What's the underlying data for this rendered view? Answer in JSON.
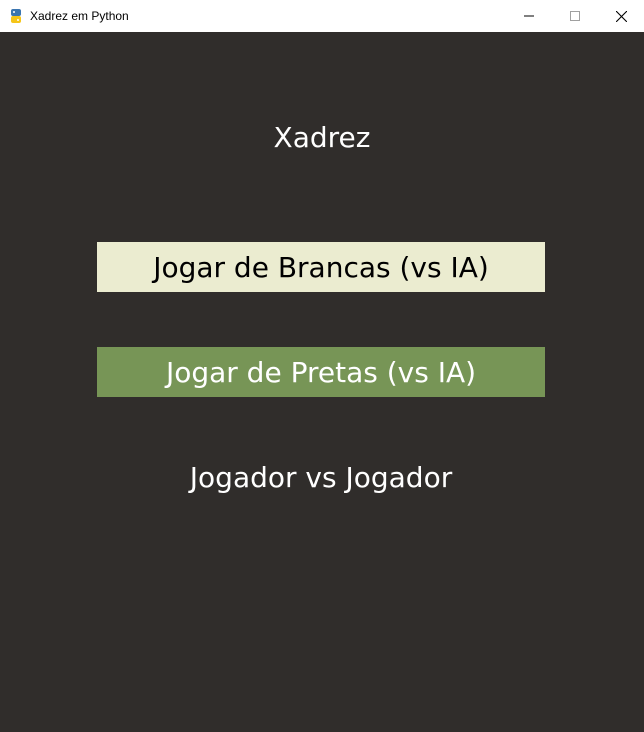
{
  "window": {
    "title": "Xadrez em Python",
    "icon": "python-icon",
    "controls": {
      "minimize_icon": "minimize-icon",
      "maximize_icon": "maximize-icon",
      "close_icon": "close-icon"
    }
  },
  "menu": {
    "title": "Xadrez",
    "buttons": [
      {
        "label": "Jogar de Brancas (vs IA)",
        "background": "#ebecd0",
        "text_color": "#000000"
      },
      {
        "label": "Jogar de Pretas (vs IA)",
        "background": "#779556",
        "text_color": "#ffffff"
      },
      {
        "label": "Jogador vs Jogador",
        "background": "#302d2b",
        "text_color": "#ffffff"
      }
    ]
  },
  "colors": {
    "background": "#302d2b",
    "titlebar": "#ffffff",
    "light_square": "#ebecd0",
    "dark_square": "#779556"
  }
}
